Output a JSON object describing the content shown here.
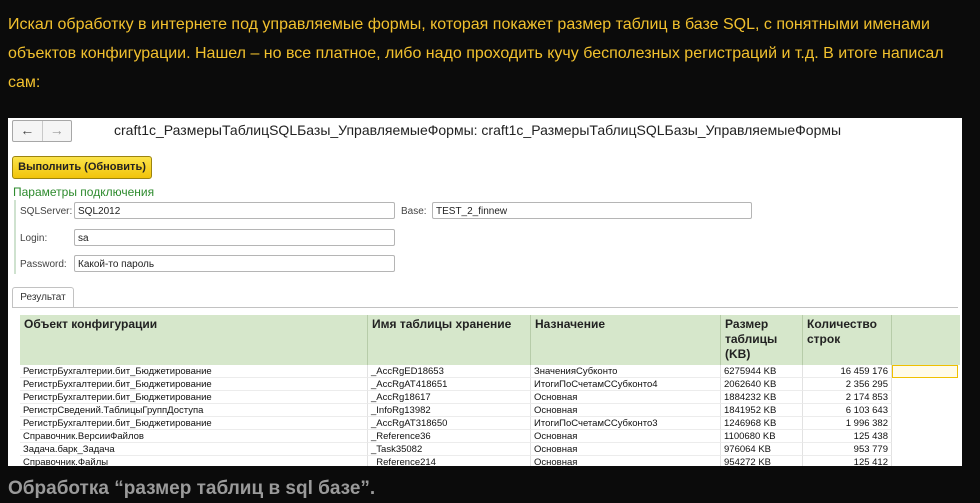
{
  "article": {
    "paragraph": "Искал обработку в интернете под управляемые формы, которая покажет размер таблиц в базе SQL, с понятными именами объектов конфигурации. Нашел – но все платное, либо надо проходить кучу бесполезных регистраций и т.д. В итоге написал сам:",
    "caption": "Обработка “размер таблиц в sql базе”."
  },
  "window": {
    "title": "craft1c_РазмерыТаблицSQLБазы_УправляемыеФормы: craft1c_РазмерыТаблицSQLБазы_УправляемыеФормы",
    "back": "←",
    "forward": "→"
  },
  "toolbar": {
    "run_label": "Выполнить (Обновить)"
  },
  "connection": {
    "group_title": "Параметры подключения",
    "sqlserver_label": "SQLServer:",
    "sqlserver_value": "SQL2012",
    "base_label": "Base:",
    "base_value": "TEST_2_finnew",
    "login_label": "Login:",
    "login_value": "sa",
    "password_label": "Password:",
    "password_value": "Какой-то пароль"
  },
  "result_tab": "Результат",
  "table": {
    "headers": [
      "Объект конфигурации",
      "Имя таблицы хранение",
      "Назначение",
      "Размер таблицы (KB)",
      "Количество строк"
    ],
    "rows": [
      [
        "РегистрБухгалтерии.бит_Бюджетирование",
        "_AccRgED18653",
        "ЗначенияСубконто",
        "6275944 KB",
        "16 459 176"
      ],
      [
        "РегистрБухгалтерии.бит_Бюджетирование",
        "_AccRgAT418651",
        "ИтогиПоСчетамССубконто4",
        "2062640 KB",
        "2 356 295"
      ],
      [
        "РегистрБухгалтерии.бит_Бюджетирование",
        "_AccRg18617",
        "Основная",
        "1884232 KB",
        "2 174 853"
      ],
      [
        "РегистрСведений.ТаблицыГруппДоступа",
        "_InfoRg13982",
        "Основная",
        "1841952 KB",
        "6 103 643"
      ],
      [
        "РегистрБухгалтерии.бит_Бюджетирование",
        "_AccRgAT318650",
        "ИтогиПоСчетамССубконто3",
        "1246968 KB",
        "1 996 382"
      ],
      [
        "Справочник.ВерсииФайлов",
        "_Reference36",
        "Основная",
        "1100680 KB",
        "125 438"
      ],
      [
        "Задача.барк_Задача",
        "_Task35082",
        "Основная",
        "976064 KB",
        "953 779"
      ],
      [
        "Справочник.Файлы",
        "_Reference214",
        "Основная",
        "954272 KB",
        "125 412"
      ]
    ]
  }
}
